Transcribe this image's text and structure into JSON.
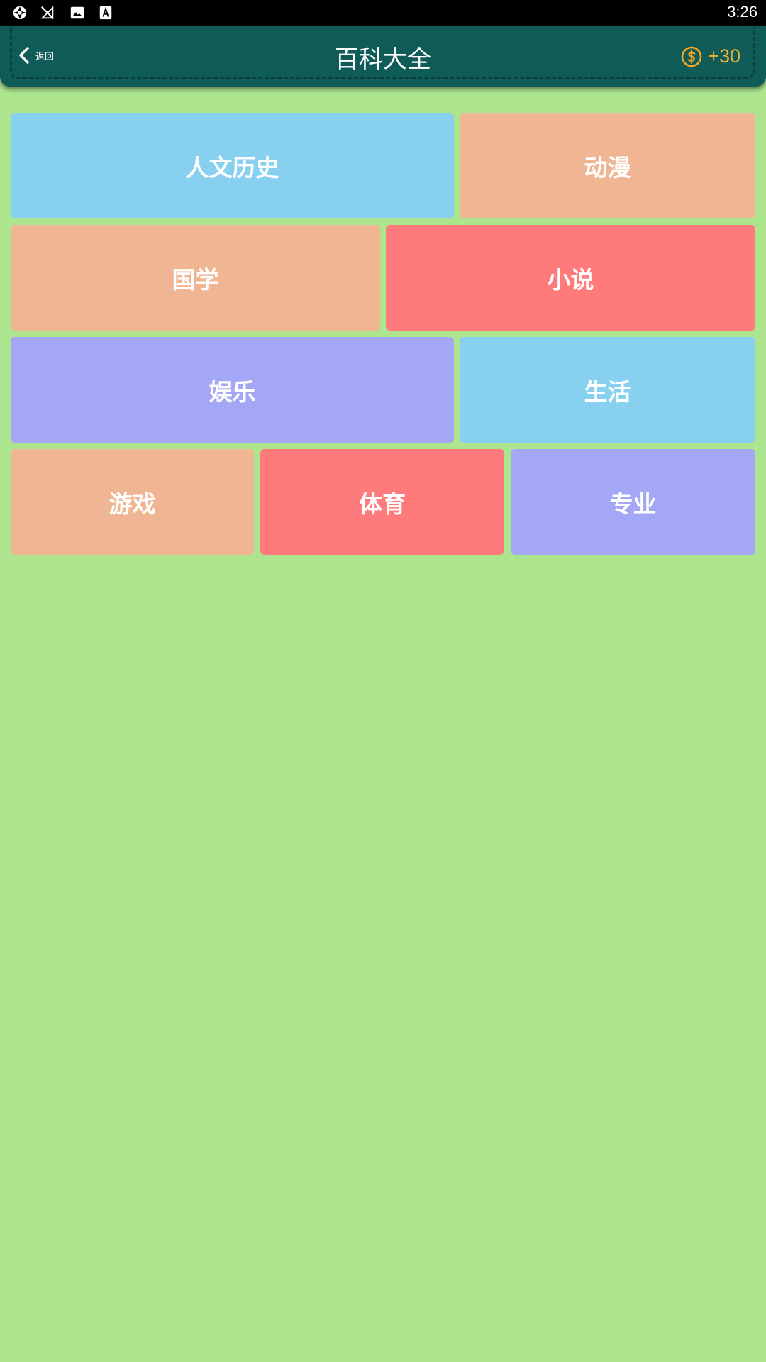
{
  "status_bar": {
    "time": "3:26",
    "icons": [
      "aperture-icon",
      "no-signal-icon",
      "image-icon",
      "font-download-icon"
    ]
  },
  "header": {
    "back_label": "返回",
    "title": "百科大全",
    "coins": "+30"
  },
  "colors": {
    "background": "#ade58f",
    "header": "#0f5b57",
    "blue": "#87d0f0",
    "peach": "#f0b693",
    "red": "#ff7b7b",
    "purple": "#a3a7f5",
    "coin": "#f5a623"
  },
  "categories": [
    {
      "label": "人文历史",
      "color": "#87d0f0"
    },
    {
      "label": "动漫",
      "color": "#f0b693"
    },
    {
      "label": "国学",
      "color": "#f0b693"
    },
    {
      "label": "小说",
      "color": "#ff7b7b"
    },
    {
      "label": "娱乐",
      "color": "#a3a7f5"
    },
    {
      "label": "生活",
      "color": "#87d0f0"
    },
    {
      "label": "游戏",
      "color": "#f0b693"
    },
    {
      "label": "体育",
      "color": "#ff7b7b"
    },
    {
      "label": "专业",
      "color": "#a3a7f5"
    }
  ]
}
